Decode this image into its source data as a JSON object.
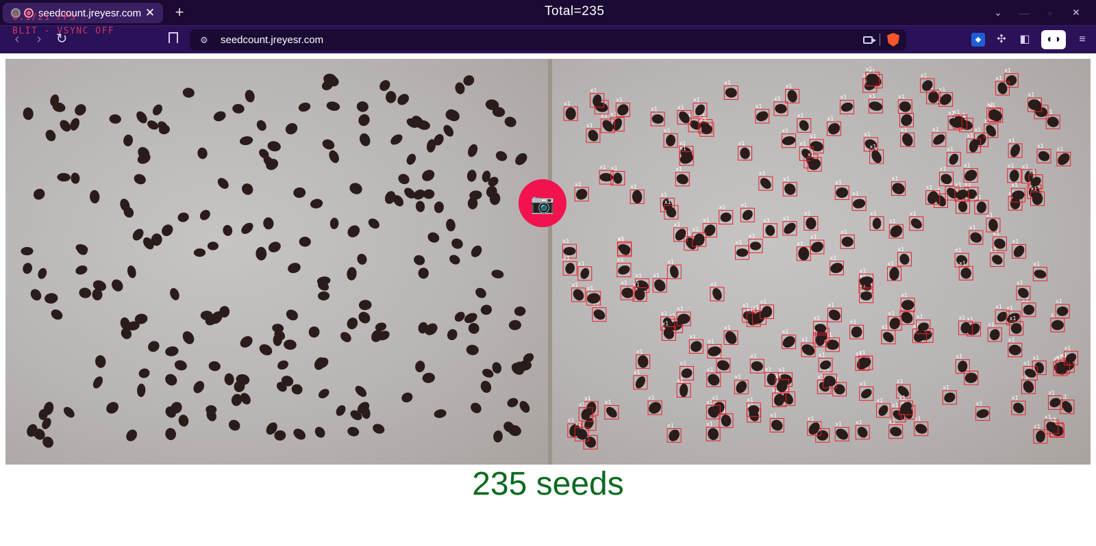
{
  "browser": {
    "tab_title": "seedcount.jreyesr.com",
    "url": "seedcount.jreyesr.com",
    "overlay_fps": "0.1/21 FPS",
    "overlay_vsync": "BLIT - VSYNC OFF"
  },
  "app": {
    "total_label": "Total=235",
    "result_label": "235 seeds",
    "shutter_icon": "camera-icon",
    "accent_color": "#f2124d",
    "result_color": "#0c6a1f",
    "box_color": "#e8202a"
  }
}
